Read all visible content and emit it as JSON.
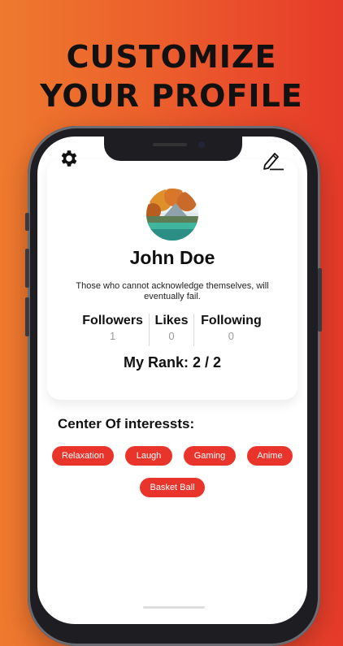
{
  "headline": {
    "line1": "CUSTOMIZE",
    "line2": "YOUR PROFILE"
  },
  "profile": {
    "name": "John Doe",
    "bio": "Those who cannot acknowledge themselves, will eventually fail.",
    "stats": [
      {
        "label": "Followers",
        "value": "1"
      },
      {
        "label": "Likes",
        "value": "0"
      },
      {
        "label": "Following",
        "value": "0"
      }
    ],
    "rank": "My Rank: 2 / 2"
  },
  "interests": {
    "title": "Center Of interessts:",
    "items": [
      "Relaxation",
      "Laugh",
      "Gaming",
      "Anime",
      "Basket Ball"
    ]
  },
  "icons": {
    "settings": "gear-icon",
    "edit": "edit-icon"
  },
  "colors": {
    "accent": "#e8342a",
    "bg_left": "#ee7a2e",
    "bg_right": "#e63a2a"
  }
}
